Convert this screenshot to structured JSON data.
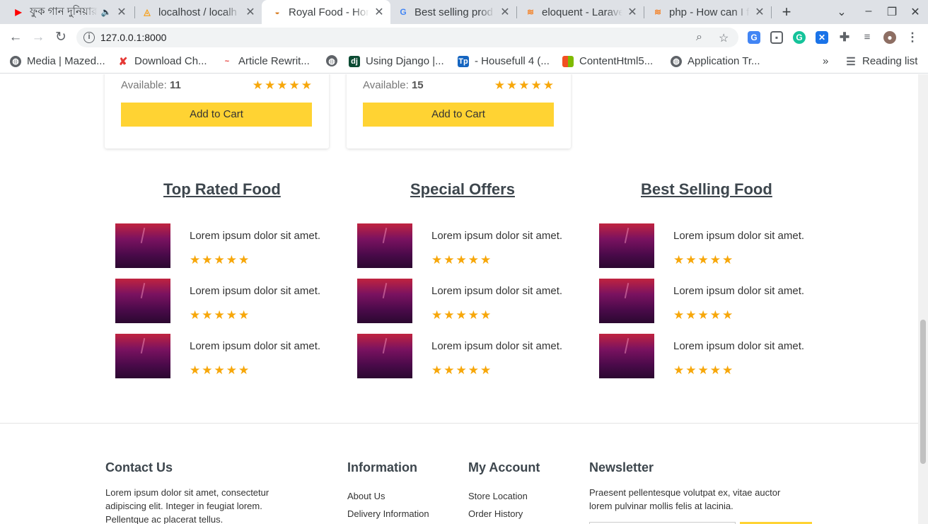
{
  "browser": {
    "tabs": [
      {
        "title": "ফুক গান দুনিয়ার গ",
        "favicon": "youtube-icon",
        "color": "#ff0000"
      },
      {
        "title": "localhost / localh",
        "favicon": "phpmyadmin-icon",
        "color": "#f89c0e"
      },
      {
        "title": "Royal Food - Hom",
        "favicon": "burger-icon",
        "color": "#d9822b"
      },
      {
        "title": "Best selling prod",
        "favicon": "google-icon",
        "color": "#4285f4"
      },
      {
        "title": "eloquent - Larave",
        "favicon": "stackoverflow-icon",
        "color": "#f48024"
      },
      {
        "title": "php - How can I fi",
        "favicon": "stackoverflow-icon",
        "color": "#f48024"
      }
    ],
    "close_glyph": "✕",
    "new_tab_glyph": "+",
    "url": "127.0.0.1:8000",
    "bookmarks": [
      {
        "label": "Media | Mazed...",
        "icon": "globe-icon"
      },
      {
        "label": "Download Ch...",
        "icon": "x-icon"
      },
      {
        "label": "Article Rewrit...",
        "icon": "article-icon"
      },
      {
        "label": "",
        "icon": "globe-icon"
      },
      {
        "label": "Using Django |...",
        "icon": "django-icon"
      },
      {
        "label": "- Housefull 4 (...",
        "icon": "video-icon"
      },
      {
        "label": "ContentHtml5...",
        "icon": "microsoft-icon"
      },
      {
        "label": "Application Tr...",
        "icon": "globe-icon"
      }
    ],
    "more_bookmarks": "»",
    "reading_list": "Reading list"
  },
  "products": [
    {
      "available_label": "Available:",
      "available": "11",
      "rating": 5,
      "button": "Add to Cart"
    },
    {
      "available_label": "Available:",
      "available": "15",
      "rating": 5,
      "button": "Add to Cart"
    }
  ],
  "sections": [
    {
      "title": "Top Rated Food",
      "items": [
        {
          "text": "Lorem ipsum dolor sit amet.",
          "rating": 5
        },
        {
          "text": "Lorem ipsum dolor sit amet.",
          "rating": 5
        },
        {
          "text": "Lorem ipsum dolor sit amet.",
          "rating": 5
        }
      ]
    },
    {
      "title": "Special Offers",
      "items": [
        {
          "text": "Lorem ipsum dolor sit amet.",
          "rating": 5
        },
        {
          "text": "Lorem ipsum dolor sit amet.",
          "rating": 5
        },
        {
          "text": "Lorem ipsum dolor sit amet.",
          "rating": 5
        }
      ]
    },
    {
      "title": "Best Selling Food",
      "items": [
        {
          "text": "Lorem ipsum dolor sit amet.",
          "rating": 5
        },
        {
          "text": "Lorem ipsum dolor sit amet.",
          "rating": 5
        },
        {
          "text": "Lorem ipsum dolor sit amet.",
          "rating": 5
        }
      ]
    }
  ],
  "footer": {
    "contact": {
      "title": "Contact Us",
      "lines": [
        "Lorem ipsum dolor sit amet, consectetur",
        "adipiscing elit. Integer in feugiat lorem.",
        "Pellentque ac placerat tellus."
      ]
    },
    "information": {
      "title": "Information",
      "links": [
        "About Us",
        "Delivery Information"
      ]
    },
    "account": {
      "title": "My Account",
      "links": [
        "Store Location",
        "Order History"
      ]
    },
    "newsletter": {
      "title": "Newsletter",
      "lines": [
        "Praesent pellentesque volutpat ex, vitae auctor",
        "lorem pulvinar mollis felis at lacinia."
      ]
    }
  },
  "colors": {
    "accent": "#ffd333",
    "star": "#f7a70a",
    "heading": "#3d464d"
  }
}
